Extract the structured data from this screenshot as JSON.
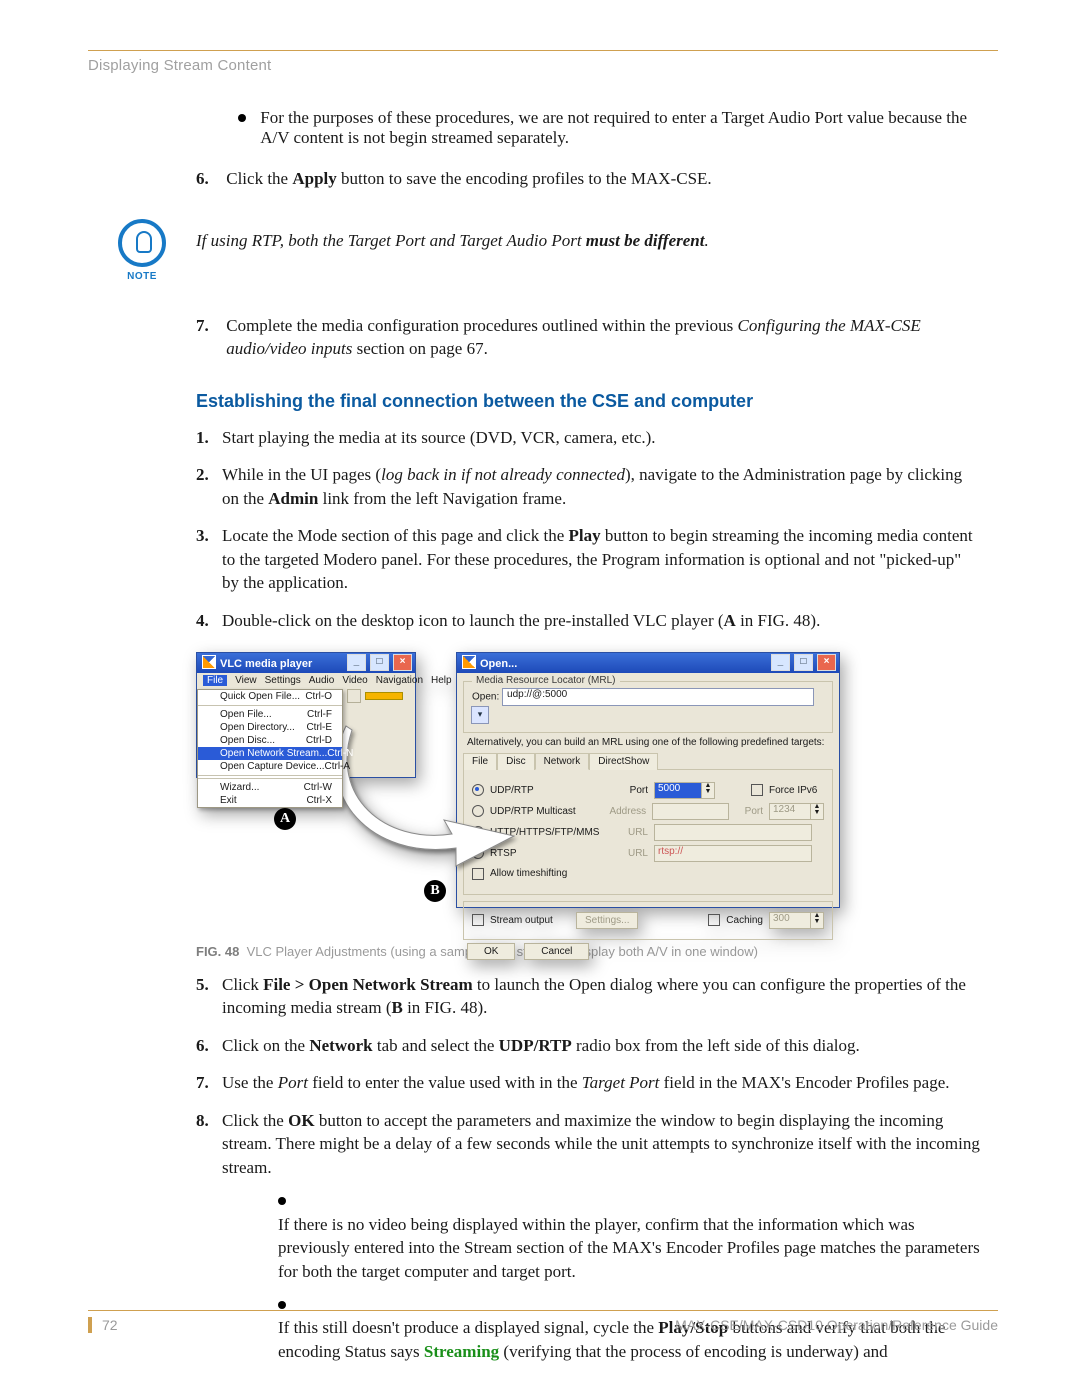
{
  "header": {
    "running": "Displaying Stream Content"
  },
  "intro_bullet": "For the purposes of these procedures, we are not required to enter a Target Audio Port value because the A/V content is not begin streamed separately.",
  "step6": {
    "n": "6.",
    "pre": "Click the ",
    "bold": "Apply",
    "post": " button to save the encoding profiles to the MAX-CSE."
  },
  "note": {
    "label": "NOTE",
    "pre": "If using RTP, both the Target Port and Target Audio Port ",
    "bold": "must be different",
    "post": "."
  },
  "step7": {
    "n": "7.",
    "pre": "Complete the media configuration procedures outlined within the previous ",
    "ital": "Configuring the MAX-CSE audio/video inputs",
    "post": " section on page 67."
  },
  "section": "Establishing the final connection between the CSE and computer",
  "steps": [
    {
      "n": "1.",
      "html": "Start playing the media at its source (DVD, VCR, camera, etc.)."
    },
    {
      "n": "2.",
      "html": "While in the UI pages (<i>log back in if not already connected</i>), navigate to the Administration page by clicking on the <b>Admin</b> link from the left Navigation frame."
    },
    {
      "n": "3.",
      "html": "Locate the Mode section of this page and click the <b>Play</b> button to begin streaming the incoming media content to the targeted Modero panel. For these procedures, the Program information is optional and not &quot;picked-up&quot; by the application."
    },
    {
      "n": "4.",
      "html": "Double-click on the desktop icon to launch the pre-installed VLC player (<b>A</b> in FIG. 48)."
    }
  ],
  "fig": {
    "vlc_title": "VLC media player",
    "menubar": [
      "File",
      "View",
      "Settings",
      "Audio",
      "Video",
      "Navigation",
      "Help"
    ],
    "file_menu": [
      {
        "l": "Quick Open File...",
        "k": "Ctrl-O"
      },
      {
        "l": "Open File...",
        "k": "Ctrl-F"
      },
      {
        "l": "Open Directory...",
        "k": "Ctrl-E"
      },
      {
        "l": "Open Disc...",
        "k": "Ctrl-D"
      },
      {
        "l": "Open Network Stream...",
        "k": "Ctrl-N",
        "hl": true
      },
      {
        "l": "Open Capture Device...",
        "k": "Ctrl-A"
      },
      {
        "l": "Wizard...",
        "k": "Ctrl-W"
      },
      {
        "l": "Exit",
        "k": "Ctrl-X"
      }
    ],
    "open_title": "Open...",
    "mrl_group": "Media Resource Locator (MRL)",
    "open_lbl": "Open:",
    "open_val": "udp://@:5000",
    "alt_line": "Alternatively, you can build an MRL using one of the following predefined targets:",
    "tabs": [
      "File",
      "Disc",
      "Network",
      "DirectShow"
    ],
    "udp": "UDP/RTP",
    "udpm": "UDP/RTP Multicast",
    "http": "HTTP/HTTPS/FTP/MMS",
    "rtsp": "RTSP",
    "port_lbl": "Port",
    "port_val": "5000",
    "force": "Force IPv6",
    "addr_lbl": "Address",
    "port2_lbl": "Port",
    "port2_val": "1234",
    "url_lbl": "URL",
    "url2_lbl": "URL",
    "rtsp_hint": "rtsp://",
    "timeshift": "Allow timeshifting",
    "stream_out": "Stream output",
    "settings_btn": "Settings...",
    "caching": "Caching",
    "caching_val": "300",
    "ok": "OK",
    "cancel": "Cancel",
    "callout_a": "A",
    "callout_b": "B",
    "caption_no": "FIG. 48",
    "caption": "VLC Player Adjustments (using a sample UDP stream to display both A/V in one window)"
  },
  "steps2": [
    {
      "n": "5.",
      "html": "Click <b>File &gt; Open Network Stream</b> to launch the Open dialog where you can configure the properties of the incoming media stream (<b>B</b> in FIG. 48)."
    },
    {
      "n": "6.",
      "html": "Click on the <b>Network</b> tab and select the <b>UDP/RTP</b> radio box from the left side of this dialog."
    },
    {
      "n": "7.",
      "html": "Use the <i>Port</i> field to enter the value used with in the <i>Target Port</i> field in the MAX's Encoder Profiles page."
    },
    {
      "n": "8.",
      "html": "Click the <b>OK</b> button to accept the parameters and maximize the window to begin displaying the incoming stream. There might be a delay of a few seconds while the unit attempts to synchronize itself with the incoming stream."
    }
  ],
  "sub2": [
    "If there is no video being displayed within the player, confirm that the information which was previously entered into the Stream section of the MAX's Encoder Profiles page matches the parameters for both the target computer and target port.",
    "If this still doesn't produce a displayed signal, cycle the <b>Play/Stop</b> buttons and verify that both the encoding Status says <span class=\"green\">Streaming</span> (verifying that the process of encoding is underway) and"
  ],
  "footer": {
    "page": "72",
    "title": "MAX-CSE/MAX-CSD10 Operation/Reference Guide"
  }
}
